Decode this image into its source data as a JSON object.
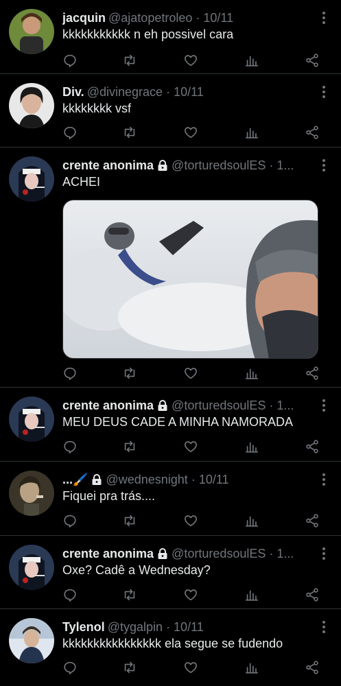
{
  "colors": {
    "background": "#000000",
    "text": "#e7e9ea",
    "muted": "#71767b",
    "divider": "#2f3336"
  },
  "tweets": [
    {
      "name": "jacquin",
      "handle": "@ajatopetroleo",
      "sep": "·",
      "time": "10/11",
      "text": "kkkkkkkkkkk n eh possivel cara",
      "locked": false,
      "avatar": "avatar-jacquin"
    },
    {
      "name": "Div.",
      "handle": "@divinegrace",
      "sep": "·",
      "time": "10/11",
      "text": "kkkkkkkk vsf",
      "locked": false,
      "avatar": "avatar-div"
    },
    {
      "name": "crente anonima",
      "handle": "@torturedsoulES",
      "sep": "·",
      "time": "1...",
      "text": "ACHEI",
      "locked": true,
      "avatar": "avatar-nun",
      "media": "snow-selfie-image"
    },
    {
      "name": "crente anonima",
      "handle": "@torturedsoulES",
      "sep": "·",
      "time": "1...",
      "text": "MEU DEUS CADE A MINHA NAMORADA",
      "locked": true,
      "avatar": "avatar-nun"
    },
    {
      "name": "...🖌️",
      "handle": "@wednesnight",
      "sep": "·",
      "time": "10/11",
      "text": "Fiquei pra trás....",
      "locked": true,
      "avatar": "avatar-wednes"
    },
    {
      "name": "crente anonima",
      "handle": "@torturedsoulES",
      "sep": "·",
      "time": "1...",
      "text": "Oxe? Cadê a Wednesday?",
      "locked": true,
      "avatar": "avatar-nun"
    },
    {
      "name": "Tylenol",
      "handle": "@tygalpin",
      "sep": "·",
      "time": "10/11",
      "text": "kkkkkkkkkkkkkkkk ela segue se fudendo",
      "locked": false,
      "avatar": "avatar-tylenol"
    }
  ],
  "icons": [
    "reply-icon",
    "retweet-icon",
    "like-icon",
    "views-icon",
    "share-icon",
    "more-icon",
    "lock-icon"
  ]
}
